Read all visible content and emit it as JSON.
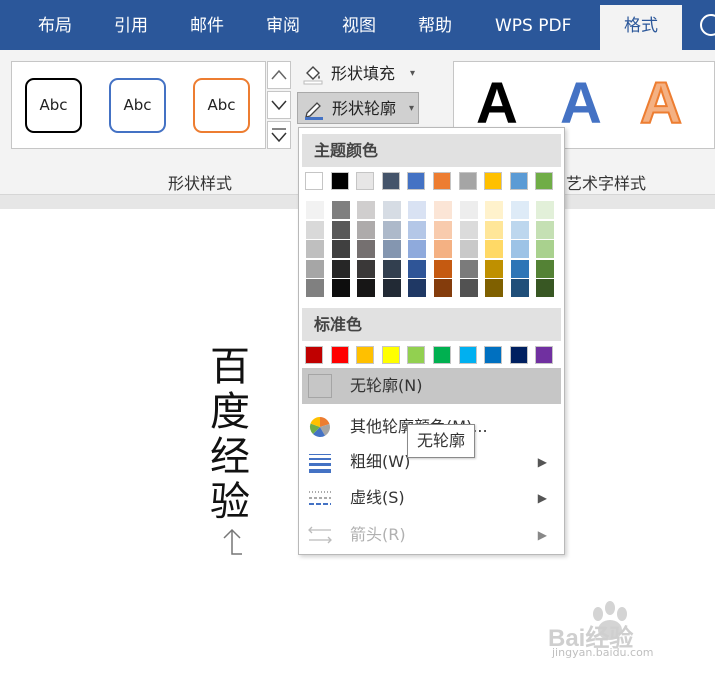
{
  "tabs": [
    {
      "label": "布局",
      "active": false
    },
    {
      "label": "引用",
      "active": false
    },
    {
      "label": "邮件",
      "active": false
    },
    {
      "label": "审阅",
      "active": false
    },
    {
      "label": "视图",
      "active": false
    },
    {
      "label": "帮助",
      "active": false
    },
    {
      "label": "WPS PDF",
      "active": false
    },
    {
      "label": "格式",
      "active": true
    }
  ],
  "shape_styles": {
    "swatches": [
      {
        "label": "Abc",
        "border": "#000000"
      },
      {
        "label": "Abc",
        "border": "#4472c4"
      },
      {
        "label": "Abc",
        "border": "#ed7d31"
      }
    ],
    "group_label": "形状样式"
  },
  "ribbon_buttons": {
    "fill": "形状填充",
    "outline": "形状轮廓"
  },
  "wordart": {
    "group_label": "艺术字样式",
    "letters": [
      {
        "label": "A",
        "color": "#000000"
      },
      {
        "label": "A",
        "color": "#4472c4"
      },
      {
        "label": "A",
        "color": "#f4b183"
      }
    ]
  },
  "document": {
    "vertical_text": [
      "百",
      "度",
      "经",
      "验"
    ]
  },
  "dropdown": {
    "theme_header": "主题颜色",
    "theme_colors": [
      "#ffffff",
      "#000000",
      "#e7e6e6",
      "#44546a",
      "#4472c4",
      "#ed7d31",
      "#a5a5a5",
      "#ffc000",
      "#5b9bd5",
      "#70ad47"
    ],
    "theme_shades": [
      [
        "#f2f2f2",
        "#d9d9d9",
        "#bfbfbf",
        "#a6a6a6",
        "#808080"
      ],
      [
        "#7f7f7f",
        "#595959",
        "#404040",
        "#262626",
        "#0d0d0d"
      ],
      [
        "#d0cece",
        "#aeabab",
        "#757070",
        "#3a3838",
        "#171616"
      ],
      [
        "#d6dce4",
        "#adb9ca",
        "#8496b0",
        "#323f4f",
        "#222a35"
      ],
      [
        "#d9e2f3",
        "#b4c7e7",
        "#8faadc",
        "#2f5597",
        "#1f3864"
      ],
      [
        "#fbe5d6",
        "#f8cbad",
        "#f4b183",
        "#c55a11",
        "#843c0c"
      ],
      [
        "#ededed",
        "#dbdbdb",
        "#c9c9c9",
        "#7b7b7b",
        "#525252"
      ],
      [
        "#fff2cc",
        "#ffe699",
        "#ffd966",
        "#bf9000",
        "#7f6000"
      ],
      [
        "#deebf7",
        "#bdd7ee",
        "#9dc3e6",
        "#2e75b6",
        "#1f4e79"
      ],
      [
        "#e2f0d9",
        "#c5e0b4",
        "#a9d18e",
        "#548235",
        "#385723"
      ]
    ],
    "standard_header": "标准色",
    "standard_colors": [
      "#c00000",
      "#ff0000",
      "#ffc000",
      "#ffff00",
      "#92d050",
      "#00b050",
      "#00b0f0",
      "#0070c0",
      "#002060",
      "#7030a0"
    ],
    "items": {
      "no_outline": "无轮廓(N)",
      "more_colors": "其他轮廓颜色(M)...",
      "weight": "粗细(W)",
      "dashes": "虚线(S)",
      "arrows": "箭头(R)"
    }
  },
  "tooltip": "无轮廓",
  "watermark": {
    "brand": "Bai经验",
    "url": "jingyan.baidu.com"
  }
}
